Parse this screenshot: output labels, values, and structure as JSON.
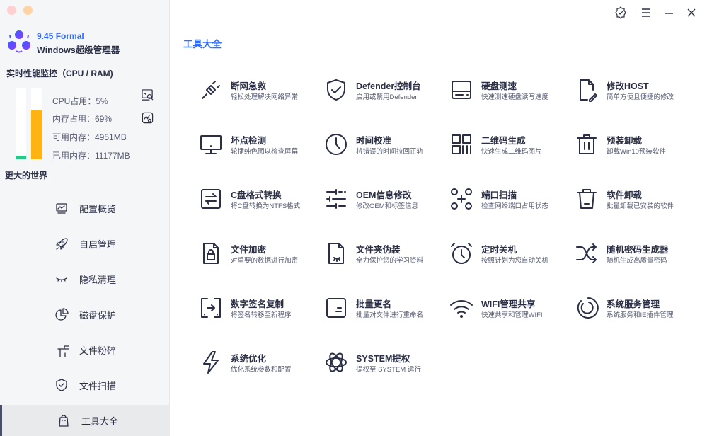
{
  "app": {
    "version": "9.45 Formal",
    "name": "Windows超级管理器"
  },
  "monitor": {
    "title": "实时性能监控（CPU / RAM)",
    "cpu_label": "CPU占用：5%",
    "mem_label": "内存占用：69%",
    "avail_label": "可用内存：4951MB",
    "used_label": "已用内存：11177MB",
    "cpu_percent": 5,
    "mem_percent": 69,
    "cpu_color": "#2ec486",
    "mem_color": "#ffb414"
  },
  "sidebar": {
    "section": "更大的世界",
    "items": [
      {
        "label": "配置概览",
        "icon": "monitor-chart"
      },
      {
        "label": "自启管理",
        "icon": "rocket"
      },
      {
        "label": "隐私清理",
        "icon": "closed-eye"
      },
      {
        "label": "磁盘保护",
        "icon": "pie-chart"
      },
      {
        "label": "文件粉碎",
        "icon": "trash"
      },
      {
        "label": "文件扫描",
        "icon": "shield-check"
      },
      {
        "label": "工具大全",
        "icon": "shopping-bag"
      }
    ]
  },
  "main": {
    "title": "工具大全",
    "tools": [
      {
        "title": "断网急救",
        "desc": "轻松处理解决网络异常",
        "icon": "plug"
      },
      {
        "title": "Defender控制台",
        "desc": "启用或禁用Defender",
        "icon": "shield"
      },
      {
        "title": "硬盘测速",
        "desc": "快速测速硬盘读写速度",
        "icon": "disk"
      },
      {
        "title": "修改HOST",
        "desc": "简单方便且便捷的修改",
        "icon": "file-edit"
      },
      {
        "title": "坏点检测",
        "desc": "轮播纯色图以检查屏幕",
        "icon": "monitor"
      },
      {
        "title": "时间校准",
        "desc": "将错误的时间拉回正轨",
        "icon": "clock"
      },
      {
        "title": "二维码生成",
        "desc": "快速生成二维码图片",
        "icon": "qrcode"
      },
      {
        "title": "预装卸载",
        "desc": "卸载Win10预装软件",
        "icon": "trash"
      },
      {
        "title": "C盘格式转换",
        "desc": "将C盘转换为NTFS格式",
        "icon": "swap"
      },
      {
        "title": "OEM信息修改",
        "desc": "修改OEM和标签信息",
        "icon": "sliders"
      },
      {
        "title": "端口扫描",
        "desc": "检查网络端口占用状态",
        "icon": "ports"
      },
      {
        "title": "软件卸载",
        "desc": "批量卸载已安装的软件",
        "icon": "bin"
      },
      {
        "title": "文件加密",
        "desc": "对重要的数据进行加密",
        "icon": "file-lock"
      },
      {
        "title": "文件夹伪装",
        "desc": "全力保护您的学习资料",
        "icon": "file-eye"
      },
      {
        "title": "定时关机",
        "desc": "按照计划为您自动关机",
        "icon": "alarm"
      },
      {
        "title": "随机密码生成器",
        "desc": "随机生成高质量密码",
        "icon": "shuffle"
      },
      {
        "title": "数字签名复制",
        "desc": "将签名转移至新程序",
        "icon": "sign-copy"
      },
      {
        "title": "批量更名",
        "desc": "批量对文件进行重命名",
        "icon": "rename"
      },
      {
        "title": "WIFI管理共享",
        "desc": "快速共享和管理WIFI",
        "icon": "wifi"
      },
      {
        "title": "系统服务管理",
        "desc": "系统服务和IE插件管理",
        "icon": "service"
      },
      {
        "title": "系统优化",
        "desc": "优化系统参数和配置",
        "icon": "bolt"
      },
      {
        "title": "SYSTEM提权",
        "desc": "提权至 SYSTEM 运行",
        "icon": "atom"
      }
    ]
  }
}
